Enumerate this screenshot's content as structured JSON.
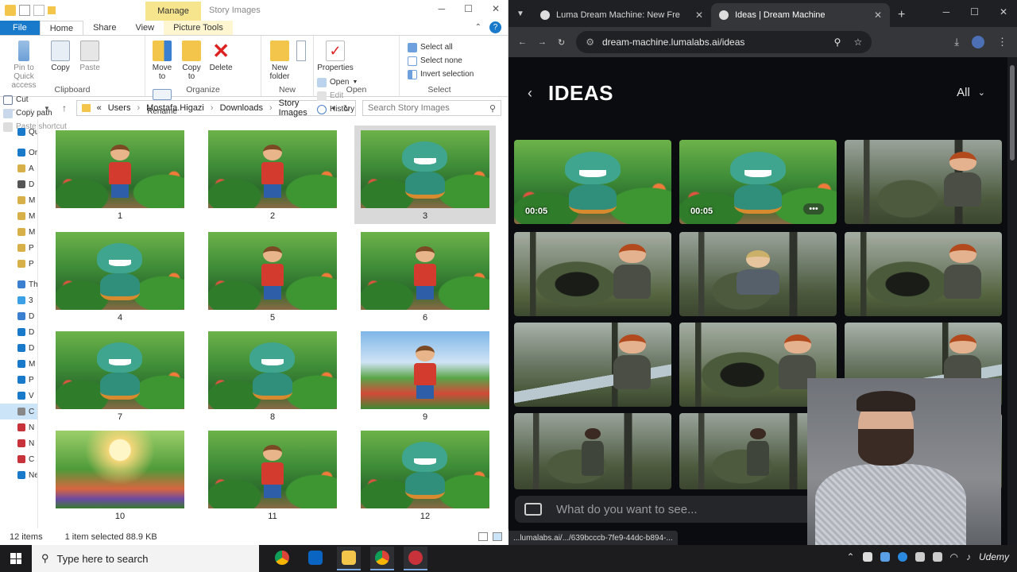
{
  "explorer": {
    "context_tab": "Manage",
    "window_title": "Story Images",
    "tabs": [
      "File",
      "Home",
      "Share",
      "View",
      "Picture Tools"
    ],
    "ribbon": {
      "clipboard": {
        "pin": "Pin to Quick access",
        "copy": "Copy",
        "paste": "Paste",
        "cut": "Cut",
        "copy_path": "Copy path",
        "paste_shortcut": "Paste shortcut",
        "label": "Clipboard"
      },
      "organize": {
        "move_to": "Move to",
        "copy_to": "Copy to",
        "delete": "Delete",
        "rename": "Rename",
        "label": "Organize"
      },
      "new": {
        "new_folder": "New folder",
        "label": "New"
      },
      "open": {
        "properties": "Properties",
        "open": "Open",
        "edit": "Edit",
        "history": "History",
        "label": "Open"
      },
      "select": {
        "select_all": "Select all",
        "select_none": "Select none",
        "invert": "Invert selection",
        "label": "Select"
      }
    },
    "breadcrumb": [
      "«",
      "Users",
      "Mostafa.Higazi",
      "Downloads",
      "Story Images"
    ],
    "search_placeholder": "Search Story Images",
    "nav_pane": [
      "Qu",
      "Or",
      "A",
      "D",
      "M",
      "M",
      "M",
      "P",
      "P",
      "Th",
      "3",
      "D",
      "D",
      "D",
      "M",
      "P",
      "V",
      "C",
      "N",
      "N",
      "C",
      "Ne"
    ],
    "files": [
      {
        "label": "1",
        "scene": "jungle",
        "char": "boy"
      },
      {
        "label": "2",
        "scene": "jungle",
        "char": "boy"
      },
      {
        "label": "3",
        "scene": "jungle",
        "char": "dino",
        "selected": true
      },
      {
        "label": "4",
        "scene": "jungle",
        "char": "dino"
      },
      {
        "label": "5",
        "scene": "jungle",
        "char": "boy"
      },
      {
        "label": "6",
        "scene": "jungle",
        "char": "boy"
      },
      {
        "label": "7",
        "scene": "jungle",
        "char": "dino"
      },
      {
        "label": "8",
        "scene": "jungle",
        "char": "dino"
      },
      {
        "label": "9",
        "scene": "sky",
        "char": "boy"
      },
      {
        "label": "10",
        "scene": "sunny",
        "char": "none"
      },
      {
        "label": "11",
        "scene": "jungle",
        "char": "boy"
      },
      {
        "label": "12",
        "scene": "jungle",
        "char": "dino"
      }
    ],
    "status": {
      "count": "12 items",
      "selected": "1 item selected  88.9 KB"
    }
  },
  "browser": {
    "tabs": [
      {
        "title": "Luma Dream Machine: New Fre",
        "active": false
      },
      {
        "title": "Ideas | Dream Machine",
        "active": true
      }
    ],
    "url": "dream-machine.lumalabs.ai/ideas",
    "page_title": "IDEAS",
    "filter_value": "All",
    "cards": [
      {
        "scene": "jungle",
        "char": "dino",
        "duration": "00:05"
      },
      {
        "scene": "jungle",
        "char": "dino",
        "duration": "00:05",
        "more": true
      },
      {
        "scene": "forest",
        "char": "redhair"
      },
      {
        "scene": "forest cave",
        "char": "redhair"
      },
      {
        "scene": "forest",
        "char": "blond"
      },
      {
        "scene": "forest cave",
        "char": "redhair"
      },
      {
        "scene": "forest stream",
        "char": "redhair"
      },
      {
        "scene": "forest cave",
        "char": "redhair"
      },
      {
        "scene": "forest stream",
        "char": "redhair"
      },
      {
        "scene": "forest",
        "char": "walker"
      },
      {
        "scene": "forest",
        "char": "walker"
      },
      {
        "scene": "forest",
        "char": "none"
      }
    ],
    "more_label": "•••",
    "prompt_placeholder": "What do you want to see...",
    "hover_url": "...lumalabs.ai/.../639bcccb-7fe9-44dc-b894-..."
  },
  "taskbar": {
    "search_placeholder": "Type here to search",
    "watermark": "Udemy"
  }
}
